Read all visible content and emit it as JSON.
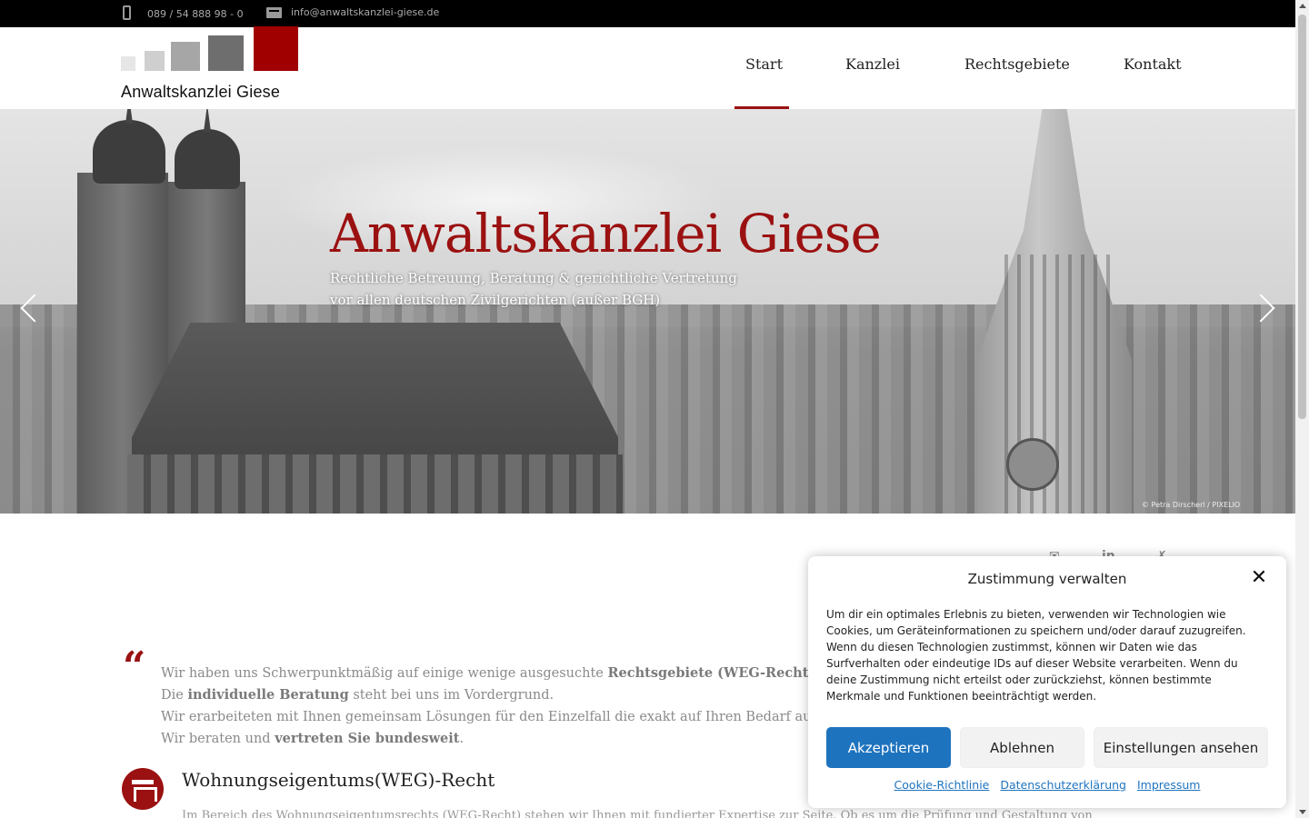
{
  "topbar": {
    "phone": "089 / 54 888 98 - 0",
    "email": "info@anwaltskanzlei-giese.de"
  },
  "logo": {
    "text": "Anwaltskanzlei Giese"
  },
  "nav": {
    "items": [
      {
        "label": "Start",
        "active": true
      },
      {
        "label": "Kanzlei",
        "active": false
      },
      {
        "label": "Rechtsgebiete",
        "active": false
      },
      {
        "label": "Kontakt",
        "active": false
      }
    ]
  },
  "hero": {
    "title": "Anwaltskanzlei Giese",
    "subtitle_line1": "Rechtliche Betreuung, Beratung & gerichtliche Vertretung",
    "subtitle_line2": "vor allen deutschen Zivilgerichten (außer BGH)",
    "copyright": "© Petra Dirscherl / PIXELIO"
  },
  "content": {
    "quote_mark": "“",
    "intro": {
      "line1_pre": "Wir haben uns Schwerpunktmäßig auf einige wenige ausgesuchte ",
      "line1_bold": "Rechtsgebiete (WEG-Recht, Mietrecht u",
      "line2_pre": "Die ",
      "line2_bold": "individuelle Beratung",
      "line2_post": " steht bei uns im Vordergrund.",
      "line3": "Wir erarbeiteten mit Ihnen gemeinsam Lösungen für den Einzelfall die exakt auf Ihren Bedarf ausgerichte",
      "line4_pre": "Wir beraten und ",
      "line4_bold": "vertreten Sie bundesweit",
      "line4_post": "."
    },
    "section_title": "Wohnungseigentums(WEG)-Recht",
    "section_text": "Im Bereich des Wohnungseigentumsrechts (WEG-Recht) stehen wir Ihnen mit fundierter Expertise zur Seite. Ob es um die Prüfung und Gestaltung von"
  },
  "consent": {
    "title": "Zustimmung verwalten",
    "close": "✕",
    "text": "Um dir ein optimales Erlebnis zu bieten, verwenden wir Technologien wie Cookies, um Geräteinformationen zu speichern und/oder darauf zuzugreifen. Wenn du diesen Technologien zustimmst, können wir Daten wie das Surfverhalten oder eindeutige IDs auf dieser Website verarbeiten. Wenn du deine Zustimmung nicht erteilst oder zurückziehst, können bestimmte Merkmale und Funktionen beeinträchtigt werden.",
    "accept": "Akzeptieren",
    "deny": "Ablehnen",
    "settings": "Einstellungen ansehen",
    "links": [
      "Cookie-Richtlinie",
      "Datenschutzerklärung",
      "Impressum"
    ]
  },
  "colors": {
    "brand_red": "#9b1111",
    "accept_blue": "#1e73be"
  },
  "icons": {
    "phone": "phone-icon",
    "email": "envelope-icon",
    "prev": "chevron-left-icon",
    "next": "chevron-right-icon",
    "close": "close-icon",
    "section": "building-icon"
  }
}
